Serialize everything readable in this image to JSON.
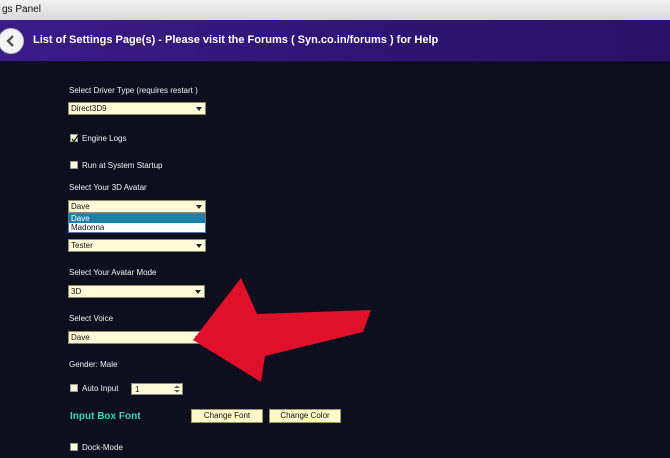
{
  "window": {
    "title": "gs Panel"
  },
  "header": {
    "text": "List of Settings Page(s) - Please visit the Forums ( Syn.co.in/forums ) for Help"
  },
  "driver": {
    "label": "Select Driver Type (requires restart )",
    "value": "Direct3D9"
  },
  "engine_logs": {
    "label": "Engine Logs",
    "checked": true
  },
  "startup": {
    "label": "Run at System Startup",
    "checked": false
  },
  "avatar": {
    "label": "Select Your 3D Avatar",
    "value": "Dave",
    "options": [
      "Dave",
      "Madonna"
    ],
    "selected_option": "Dave"
  },
  "profile": {
    "value": "Tester"
  },
  "avatar_mode": {
    "label": "Select Your Avatar Mode",
    "value": "3D"
  },
  "voice": {
    "label": "Select Voice",
    "value": "Dave"
  },
  "gender": {
    "label": "Gender: Male"
  },
  "auto_input": {
    "label": "Auto Input",
    "checked": false,
    "value": "1"
  },
  "input_box_font": {
    "label": "Input Box Font",
    "change_font": "Change Font",
    "change_color": "Change Color",
    "accent_color": "#37d7b5"
  },
  "dock_mode": {
    "label": "Dock-Mode",
    "checked": false
  },
  "colors": {
    "header_bg": "#2d1472",
    "page_bg": "#0d0f1e",
    "field_bg": "#fffbd8",
    "arrow": "#e0102a"
  }
}
